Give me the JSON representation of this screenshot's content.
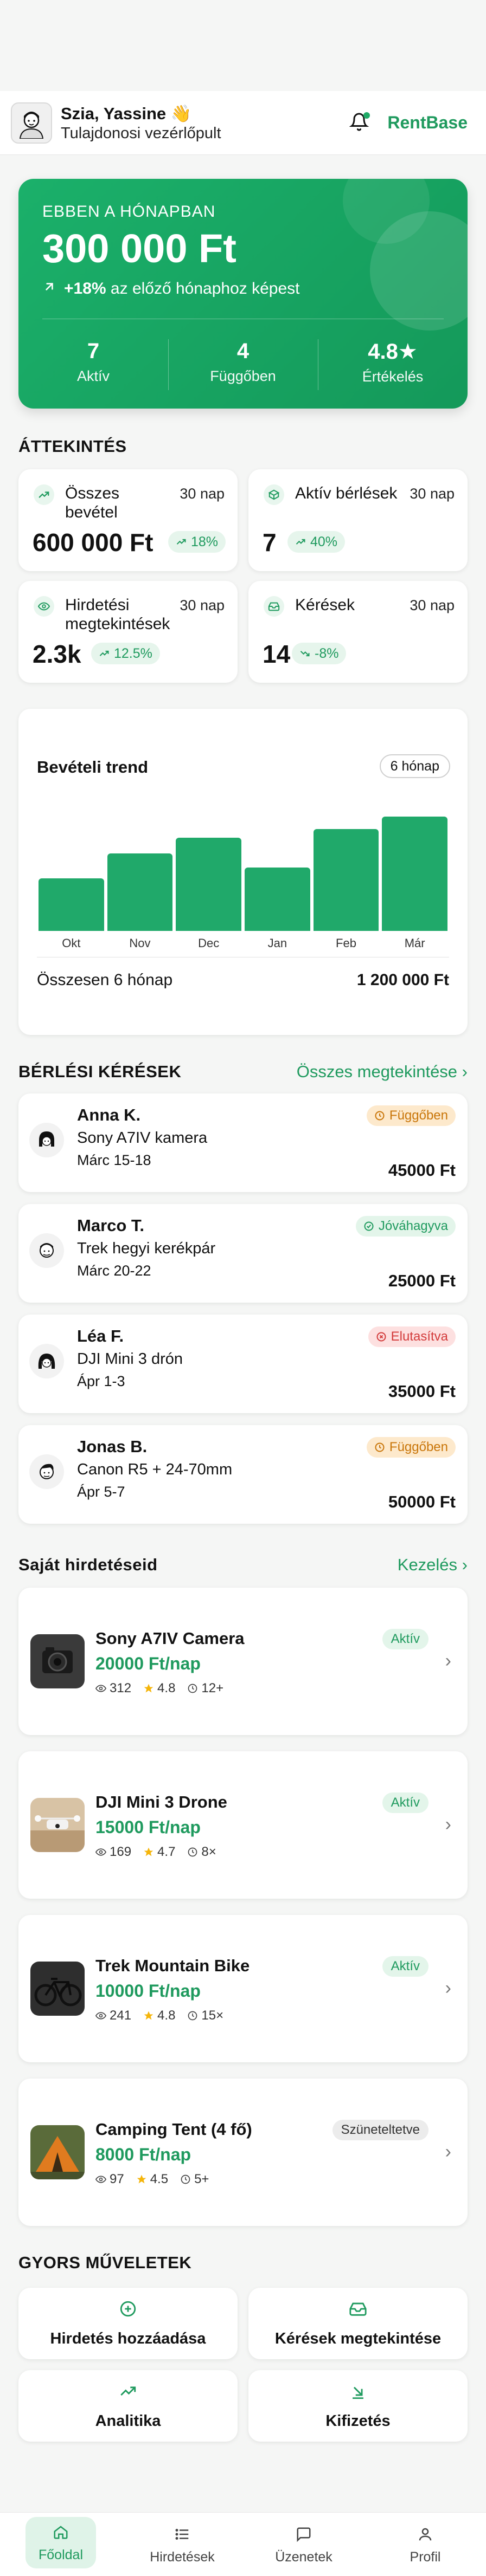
{
  "header": {
    "greeting": "Szia, Yassine 👋",
    "subtitle": "Tulajdonosi vezérlőpult",
    "brand": "RentBase"
  },
  "hero": {
    "label": "EBBEN A HÓNAPBAN",
    "amount": "300 000 Ft",
    "change_value": "+18%",
    "change_text": "az előző hónaphoz képest",
    "stats": [
      {
        "value": "7",
        "label": "Aktív"
      },
      {
        "value": "4",
        "label": "Függőben"
      },
      {
        "value": "4.8★",
        "label": "Értékelés"
      }
    ]
  },
  "overview": {
    "title": "ÁTTEKINTÉS",
    "cards": [
      {
        "label": "Összes bevétel",
        "period": "30 nap",
        "value": "600 000 Ft",
        "change": "18%",
        "icon": "trend-up-icon"
      },
      {
        "label": "Aktív bérlések",
        "period": "30 nap",
        "value": "7",
        "change": "40%",
        "icon": "box-icon"
      },
      {
        "label": "Hirdetési megtekintések",
        "period": "30 nap",
        "value": "2.3k",
        "change": "12.5%",
        "icon": "eye-icon"
      },
      {
        "label": "Kérések",
        "period": "30 nap",
        "value": "14",
        "change": "-8%",
        "icon": "inbox-icon"
      }
    ]
  },
  "trend": {
    "title": "Bevételi trend",
    "range": "6 hónap",
    "total_label": "Összesen 6 hónap",
    "total_value": "1 200 000 Ft"
  },
  "chart_data": {
    "type": "bar",
    "title": "Bevételi trend",
    "categories": [
      "Okt",
      "Nov",
      "Dec",
      "Jan",
      "Feb",
      "Már"
    ],
    "values": [
      150000,
      220000,
      265000,
      180000,
      290000,
      325000
    ],
    "ylim": [
      0,
      400000
    ],
    "grid": false
  },
  "requests": {
    "title": "BÉRLÉSI KÉRÉSEK",
    "link": "Összes megtekintése ›",
    "items": [
      {
        "name": "Anna K.",
        "item": "Sony A7IV kamera",
        "date": "Márc 15-18",
        "status": "Függőben",
        "price": "45000 Ft"
      },
      {
        "name": "Marco T.",
        "item": "Trek hegyi kerékpár",
        "date": "Márc 20-22",
        "status": "Jóváhagyva",
        "price": "25000 Ft"
      },
      {
        "name": "Léa F.",
        "item": "DJI Mini 3 drón",
        "date": "Ápr 1-3",
        "status": "Elutasítva",
        "price": "35000 Ft"
      },
      {
        "name": "Jonas B.",
        "item": "Canon R5 + 24-70mm",
        "date": "Ápr 5-7",
        "status": "Függőben",
        "price": "50000 Ft"
      }
    ]
  },
  "listings": {
    "title": "Saját hirdetéseid",
    "link": "Kezelés ›",
    "items": [
      {
        "title": "Sony A7IV Camera",
        "price": "20000 Ft/nap",
        "views": "312",
        "rating": "4.8",
        "rentals": "12+",
        "status": "Aktív"
      },
      {
        "title": "DJI Mini 3 Drone",
        "price": "15000 Ft/nap",
        "views": "169",
        "rating": "4.7",
        "rentals": "8×",
        "status": "Aktív"
      },
      {
        "title": "Trek Mountain Bike",
        "price": "10000 Ft/nap",
        "views": "241",
        "rating": "4.8",
        "rentals": "15×",
        "status": "Aktív"
      },
      {
        "title": "Camping Tent (4 fő)",
        "price": "8000 Ft/nap",
        "views": "97",
        "rating": "4.5",
        "rentals": "5+",
        "status": "Szüneteltetve"
      }
    ]
  },
  "quick": {
    "title": "GYORS MŰVELETEK",
    "actions": [
      "Hirdetés hozzáadása",
      "Kérések megtekintése",
      "Analitika",
      "Kifizetés"
    ]
  },
  "tabs": [
    "Főoldal",
    "Hirdetések",
    "Üzenetek",
    "Profil"
  ],
  "colors": {
    "accent": "#1f9a5e",
    "pending": "#c9760a",
    "rejected": "#d33b3b"
  }
}
